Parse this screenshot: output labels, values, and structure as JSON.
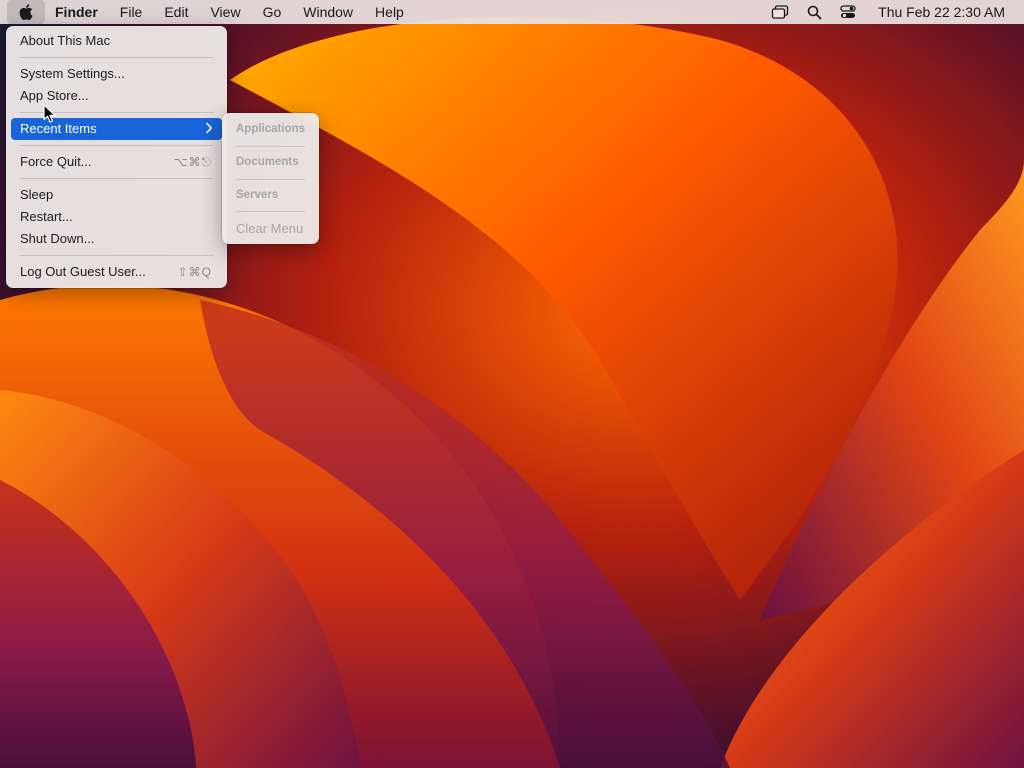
{
  "menubar": {
    "app_name": "Finder",
    "menus": [
      "File",
      "Edit",
      "View",
      "Go",
      "Window",
      "Help"
    ],
    "clock": "Thu Feb 22  2:30 AM",
    "status_icons": [
      "stage-manager-icon",
      "spotlight-search-icon",
      "control-center-icon"
    ]
  },
  "apple_menu": {
    "items": [
      {
        "label": "About This Mac"
      },
      {
        "label": "System Settings..."
      },
      {
        "label": "App Store..."
      },
      {
        "label": "Recent Items",
        "highlighted": true,
        "has_submenu": true
      },
      {
        "label": "Force Quit...",
        "shortcut": "⌥⌘⎋"
      },
      {
        "label": "Sleep"
      },
      {
        "label": "Restart..."
      },
      {
        "label": "Shut Down..."
      },
      {
        "label": "Log Out Guest User...",
        "shortcut": "⇧⌘Q"
      }
    ]
  },
  "recent_items_submenu": {
    "items": [
      {
        "label": "Applications",
        "enabled": false
      },
      {
        "label": "Documents",
        "enabled": false
      },
      {
        "label": "Servers",
        "enabled": false
      },
      {
        "label": "Clear Menu",
        "enabled": false
      }
    ]
  },
  "colors": {
    "highlight": "#1964d8",
    "menubar_bg": "#ece2e2",
    "disabled_text": "#a7a7a7"
  }
}
